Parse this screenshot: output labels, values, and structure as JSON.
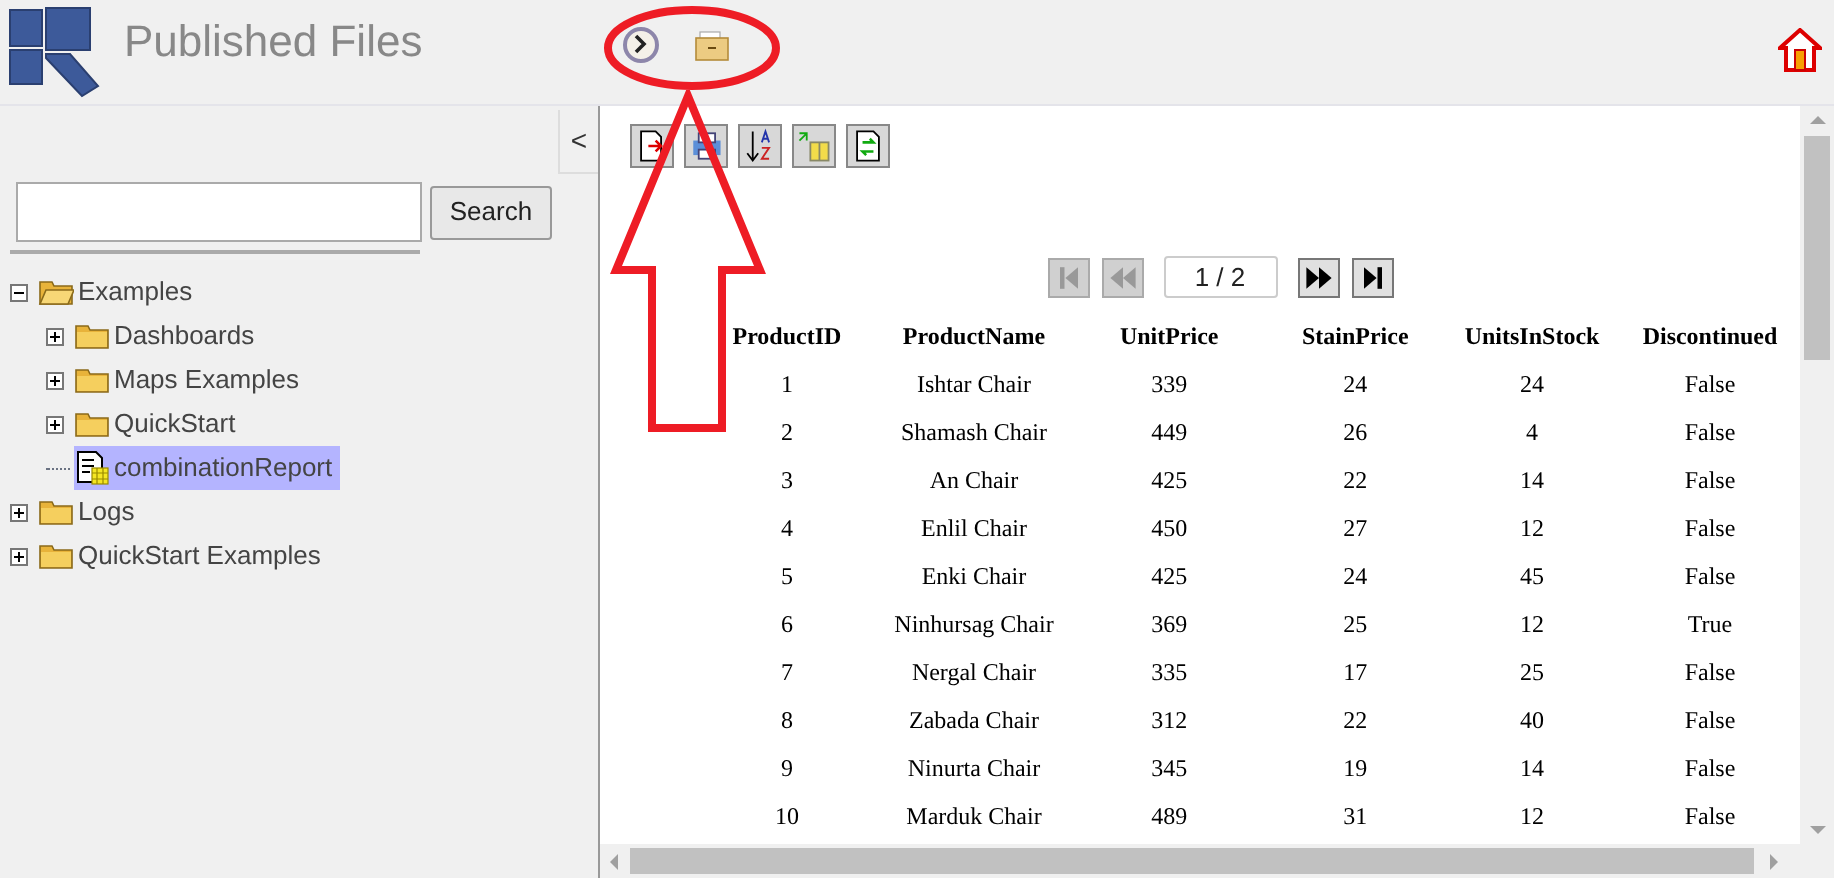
{
  "header": {
    "title": "Published Files"
  },
  "sidebar": {
    "collapse_label": "<",
    "search": {
      "button": "Search"
    },
    "tree": [
      {
        "label": "Examples",
        "kind": "folder",
        "expanded": true,
        "selected": false,
        "children": [
          {
            "label": "Dashboards",
            "kind": "folder",
            "expanded": false,
            "selected": false
          },
          {
            "label": "Maps Examples",
            "kind": "folder",
            "expanded": false,
            "selected": false
          },
          {
            "label": "QuickStart",
            "kind": "folder",
            "expanded": false,
            "selected": false
          },
          {
            "label": "combinationReport",
            "kind": "report",
            "selected": true
          }
        ]
      },
      {
        "label": "Logs",
        "kind": "folder",
        "expanded": false,
        "selected": false
      },
      {
        "label": "QuickStart Examples",
        "kind": "folder",
        "expanded": false,
        "selected": false
      }
    ]
  },
  "pager": {
    "page": "1 / 2",
    "first_disabled": true,
    "prev_disabled": true,
    "next_disabled": false,
    "last_disabled": false
  },
  "table": {
    "columns": [
      "ProductID",
      "ProductName",
      "UnitPrice",
      "StainPrice",
      "UnitsInStock",
      "Discontinued"
    ],
    "rows": [
      [
        "1",
        "Ishtar Chair",
        "339",
        "24",
        "24",
        "False"
      ],
      [
        "2",
        "Shamash Chair",
        "449",
        "26",
        "4",
        "False"
      ],
      [
        "3",
        "An Chair",
        "425",
        "22",
        "14",
        "False"
      ],
      [
        "4",
        "Enlil Chair",
        "450",
        "27",
        "12",
        "False"
      ],
      [
        "5",
        "Enki Chair",
        "425",
        "24",
        "45",
        "False"
      ],
      [
        "6",
        "Ninhursag Chair",
        "369",
        "25",
        "12",
        "True"
      ],
      [
        "7",
        "Nergal Chair",
        "335",
        "17",
        "25",
        "False"
      ],
      [
        "8",
        "Zabada Chair",
        "312",
        "22",
        "40",
        "False"
      ],
      [
        "9",
        "Ninurta Chair",
        "345",
        "19",
        "14",
        "False"
      ],
      [
        "10",
        "Marduk Chair",
        "489",
        "31",
        "12",
        "False"
      ]
    ]
  }
}
